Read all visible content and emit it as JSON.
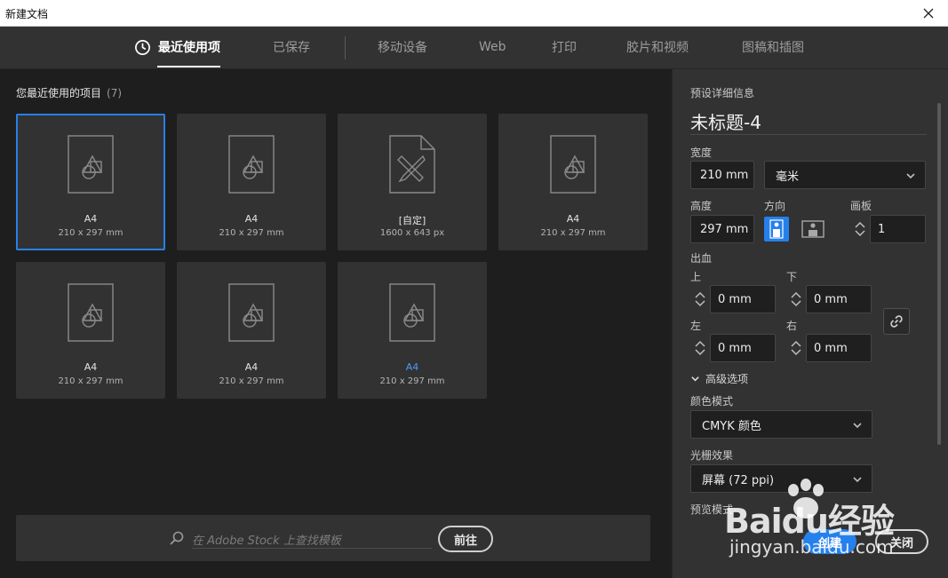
{
  "window": {
    "title": "新建文档"
  },
  "tabs": [
    {
      "label": "最近使用项",
      "active": true
    },
    {
      "label": "已保存"
    },
    {
      "label": "移动设备"
    },
    {
      "label": "Web"
    },
    {
      "label": "打印"
    },
    {
      "label": "胶片和视频"
    },
    {
      "label": "图稿和插图"
    }
  ],
  "recent": {
    "title": "您最近使用的项目",
    "count": "(7)",
    "items": [
      {
        "name": "A4",
        "size": "210 x 297 mm",
        "icon": "document-shapes-icon",
        "selected": true
      },
      {
        "name": "A4",
        "size": "210 x 297 mm",
        "icon": "document-shapes-icon"
      },
      {
        "name": "[自定]",
        "size": "1600 x 643 px",
        "icon": "document-ruler-pencil-icon"
      },
      {
        "name": "A4",
        "size": "210 x 297 mm",
        "icon": "document-shapes-icon"
      },
      {
        "name": "A4",
        "size": "210 x 297 mm",
        "icon": "document-shapes-icon"
      },
      {
        "name": "A4",
        "size": "210 x 297 mm",
        "icon": "document-shapes-icon"
      },
      {
        "name": "A4",
        "size": "210 x 297 mm",
        "icon": "document-shapes-icon",
        "highlight": true
      }
    ]
  },
  "search": {
    "placeholder": "在 Adobe Stock 上查找模板",
    "go_label": "前往"
  },
  "details": {
    "heading": "预设详细信息",
    "doc_name": "未标题-4",
    "width_label": "宽度",
    "width_value": "210 mm",
    "units_value": "毫米",
    "height_label": "高度",
    "height_value": "297 mm",
    "orientation_label": "方向",
    "artboards_label": "画板",
    "artboards_value": "1",
    "bleed_label": "出血",
    "top_label": "上",
    "top_value": "0 mm",
    "bottom_label": "下",
    "bottom_value": "0 mm",
    "left_label": "左",
    "left_value": "0 mm",
    "right_label": "右",
    "right_value": "0 mm",
    "advanced_label": "高级选项",
    "color_mode_label": "颜色模式",
    "color_mode_value": "CMYK 颜色",
    "raster_label": "光栅效果",
    "raster_value": "屏幕 (72 ppi)",
    "preview_label": "预览模式",
    "create_label": "创建",
    "close_label": "关闭"
  },
  "watermark": {
    "brand": "Baidu经验",
    "url": "jingyan.baidu.com"
  },
  "colors": {
    "accent": "#2680eb",
    "panel": "#323232",
    "background": "#1e1e1e"
  }
}
